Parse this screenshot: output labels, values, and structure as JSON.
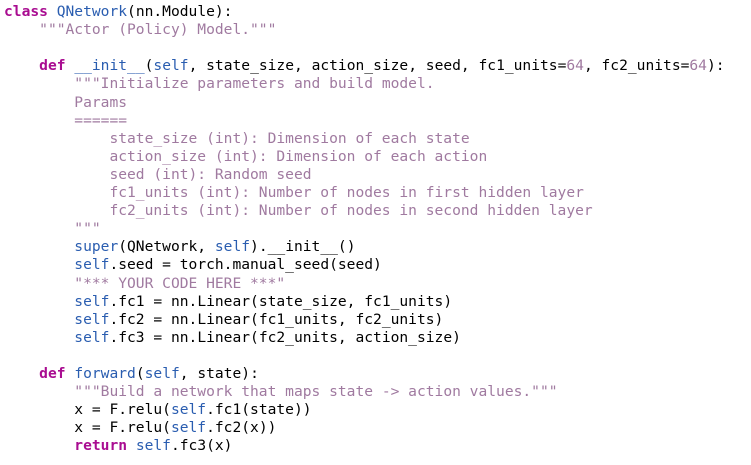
{
  "theme": {
    "background": "#ffffff",
    "keyword_color": "#a90d91",
    "name_color": "#2a5db0",
    "string_color": "#a07aa0",
    "text_color": "#000000"
  },
  "code": {
    "lines": [
      [
        {
          "t": "class",
          "k": "kw"
        },
        {
          "t": " "
        },
        {
          "t": "QNetwork",
          "k": "fn"
        },
        {
          "t": "(nn.Module):"
        }
      ],
      [
        {
          "t": "    "
        },
        {
          "t": "\"\"\"Actor (Policy) Model.\"\"\"",
          "k": "dc"
        }
      ],
      [],
      [
        {
          "t": "    "
        },
        {
          "t": "def",
          "k": "kw"
        },
        {
          "t": " "
        },
        {
          "t": "__init__",
          "k": "fn"
        },
        {
          "t": "("
        },
        {
          "t": "self",
          "k": "sf"
        },
        {
          "t": ", state_size, action_size, seed, fc1_units="
        },
        {
          "t": "64",
          "k": "num"
        },
        {
          "t": ", fc2_units="
        },
        {
          "t": "64",
          "k": "num"
        },
        {
          "t": "):"
        }
      ],
      [
        {
          "t": "        "
        },
        {
          "t": "\"\"\"Initialize parameters and build model.",
          "k": "dc"
        }
      ],
      [
        {
          "t": "        "
        },
        {
          "t": "Params",
          "k": "dc"
        }
      ],
      [
        {
          "t": "        "
        },
        {
          "t": "======",
          "k": "dc"
        }
      ],
      [
        {
          "t": "            "
        },
        {
          "t": "state_size (int): Dimension of each state",
          "k": "dc"
        }
      ],
      [
        {
          "t": "            "
        },
        {
          "t": "action_size (int): Dimension of each action",
          "k": "dc"
        }
      ],
      [
        {
          "t": "            "
        },
        {
          "t": "seed (int): Random seed",
          "k": "dc"
        }
      ],
      [
        {
          "t": "            "
        },
        {
          "t": "fc1_units (int): Number of nodes in first hidden layer",
          "k": "dc"
        }
      ],
      [
        {
          "t": "            "
        },
        {
          "t": "fc2_units (int): Number of nodes in second hidden layer",
          "k": "dc"
        }
      ],
      [
        {
          "t": "        "
        },
        {
          "t": "\"\"\"",
          "k": "dc"
        }
      ],
      [
        {
          "t": "        "
        },
        {
          "t": "super",
          "k": "sf"
        },
        {
          "t": "(QNetwork, "
        },
        {
          "t": "self",
          "k": "sf"
        },
        {
          "t": ").__init__()"
        }
      ],
      [
        {
          "t": "        "
        },
        {
          "t": "self",
          "k": "sf"
        },
        {
          "t": ".seed = torch.manual_seed(seed)"
        }
      ],
      [
        {
          "t": "        "
        },
        {
          "t": "\"*** YOUR CODE HERE ***\"",
          "k": "dc"
        }
      ],
      [
        {
          "t": "        "
        },
        {
          "t": "self",
          "k": "sf"
        },
        {
          "t": ".fc1 = nn.Linear(state_size, fc1_units)"
        }
      ],
      [
        {
          "t": "        "
        },
        {
          "t": "self",
          "k": "sf"
        },
        {
          "t": ".fc2 = nn.Linear(fc1_units, fc2_units)"
        }
      ],
      [
        {
          "t": "        "
        },
        {
          "t": "self",
          "k": "sf"
        },
        {
          "t": ".fc3 = nn.Linear(fc2_units, action_size)"
        }
      ],
      [],
      [
        {
          "t": "    "
        },
        {
          "t": "def",
          "k": "kw"
        },
        {
          "t": " "
        },
        {
          "t": "forward",
          "k": "fn"
        },
        {
          "t": "("
        },
        {
          "t": "self",
          "k": "sf"
        },
        {
          "t": ", state):"
        }
      ],
      [
        {
          "t": "        "
        },
        {
          "t": "\"\"\"Build a network that maps state -> action values.\"\"\"",
          "k": "dc"
        }
      ],
      [
        {
          "t": "        "
        },
        {
          "t": "x = F.relu("
        },
        {
          "t": "self",
          "k": "sf"
        },
        {
          "t": ".fc1(state))"
        }
      ],
      [
        {
          "t": "        "
        },
        {
          "t": "x = F.relu("
        },
        {
          "t": "self",
          "k": "sf"
        },
        {
          "t": ".fc2(x))"
        }
      ],
      [
        {
          "t": "        "
        },
        {
          "t": "return",
          "k": "kw"
        },
        {
          "t": " "
        },
        {
          "t": "self",
          "k": "sf"
        },
        {
          "t": ".fc3(x)"
        }
      ]
    ]
  }
}
